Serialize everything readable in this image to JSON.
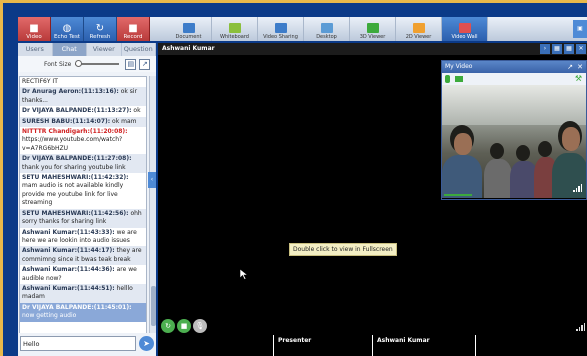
{
  "toolbar": {
    "buttons": [
      {
        "label": "Video",
        "icon": "video-icon",
        "style": "red"
      },
      {
        "label": "Echo Test",
        "icon": "echo-icon",
        "style": "blue"
      },
      {
        "label": "Refresh",
        "icon": "refresh-icon",
        "style": "blue"
      },
      {
        "label": "Record",
        "icon": "record-icon",
        "style": "red"
      }
    ],
    "tools": [
      {
        "label": "Document",
        "icon": "document-icon",
        "color": "#3d7cc9"
      },
      {
        "label": "Whiteboard",
        "icon": "whiteboard-icon",
        "color": "#8bbf3c"
      },
      {
        "label": "Video Sharing",
        "icon": "video-sharing-icon",
        "color": "#3d7cc9"
      },
      {
        "label": "Desktop",
        "icon": "desktop-icon",
        "color": "#5b9bd5"
      },
      {
        "label": "3D Viewer",
        "icon": "3d-viewer-icon",
        "color": "#3caa3c"
      },
      {
        "label": "2D Viewer",
        "icon": "2d-viewer-icon",
        "color": "#f0a030"
      },
      {
        "label": "Video Wall",
        "icon": "video-wall-icon",
        "color": "#e05050"
      }
    ]
  },
  "left_panel": {
    "tabs": [
      "Users",
      "Chat",
      "Viewer",
      "Question"
    ],
    "active_tab": "Chat",
    "font_size_label": "Font Size",
    "chat_input_value": "Hello",
    "messages": [
      {
        "who": "",
        "text": "RECTIF6Y IT"
      },
      {
        "who": "Dr Anurag  Aeron:(11:13:16):",
        "text": " ok sir thanks..."
      },
      {
        "who": "Dr VIJAYA  BALPANDE:(11:13:27):",
        "text": " ok"
      },
      {
        "who": "SURESH  BABU:(11:14:07):",
        "text": " ok mam"
      },
      {
        "who": "NITTTR Chandigarh:(11:20:08):",
        "text": " https://www.youtube.com/watch?v=A7RG6bHZU",
        "red": true
      },
      {
        "who": "Dr VIJAYA  BALPANDE:(11:27:08):",
        "text": " thank you for sharing youtube link"
      },
      {
        "who": "SETU MAHESHWARI:(11:42:32):",
        "text": " mam audio is not available kindly provide me youtube link for live streaming"
      },
      {
        "who": "SETU MAHESHWARI:(11:42:56):",
        "text": " ohh sorry thanks for sharing link"
      },
      {
        "who": "Ashwani  Kumar:(11:43:33):",
        "text": " we are here we are  lookin into audio issues"
      },
      {
        "who": "Ashwani  Kumar:(11:44:17):",
        "text": " they are commimng since it bwas teak break"
      },
      {
        "who": "Ashwani  Kumar:(11:44:36):",
        "text": " are we audible now?"
      },
      {
        "who": "Ashwani  Kumar:(11:44:51):",
        "text": " helllo madam"
      },
      {
        "who": "Dr VIJAYA  BALPANDE:(11:45:01):",
        "text": " now getting audio",
        "selected": true
      }
    ]
  },
  "main": {
    "title": "Ashwani  Kumar",
    "fullscreen_hint": "Double click to view in Fullscreen",
    "bottom": {
      "presenter_label": "Presenter",
      "presenter_name": "Ashwani  Kumar"
    }
  },
  "my_video": {
    "title": "My Video"
  }
}
